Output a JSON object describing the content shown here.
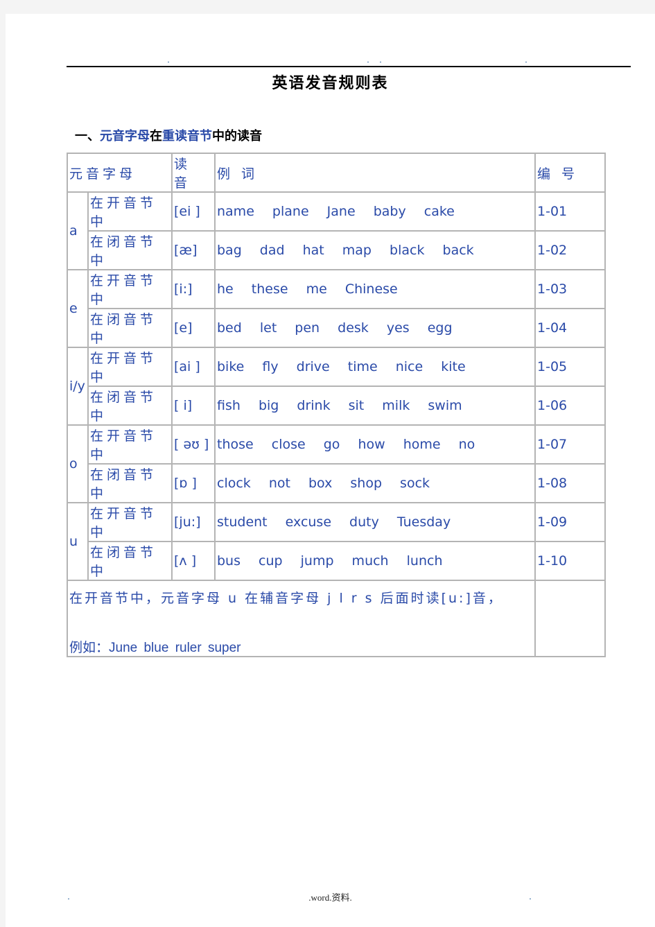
{
  "document": {
    "title": "英语发音规则表",
    "section_heading": {
      "number": "一、",
      "part1": "元音字母",
      "part2": "在",
      "part3": "重读音节",
      "part4": "中的读音"
    },
    "table": {
      "headers": {
        "vowel": "元音字母",
        "pronunciation": "读 音",
        "examples": "例 词",
        "number": "编 号"
      },
      "groups": [
        {
          "letter": "a",
          "rows": [
            {
              "syllable": "在开音节中",
              "ipa": "[ei ]",
              "words": "name plane Jane baby cake",
              "code": "1-01"
            },
            {
              "syllable": "在闭音节中",
              "ipa": "[æ]",
              "words": "bag dad hat map black back",
              "code": "1-02"
            }
          ]
        },
        {
          "letter": "e",
          "rows": [
            {
              "syllable": "在开音节中",
              "ipa": "[i:]",
              "words": "he these me Chinese",
              "code": "1-03"
            },
            {
              "syllable": "在闭音节中",
              "ipa": "[e]",
              "words": "bed let pen desk yes egg",
              "code": "1-04"
            }
          ]
        },
        {
          "letter": "i/y",
          "rows": [
            {
              "syllable": "在开音节中",
              "ipa": "[ai ]",
              "words": "bike fly drive time nice kite",
              "code": "1-05"
            },
            {
              "syllable": "在闭音节中",
              "ipa": "[ i]",
              "words": "fish big drink sit milk swim",
              "code": "1-06"
            }
          ]
        },
        {
          "letter": "o",
          "rows": [
            {
              "syllable": "在开音节中",
              "ipa": "[ əʊ ]",
              "words": "those close go how home no",
              "code": "1-07"
            },
            {
              "syllable": "在闭音节中",
              "ipa": "[ɒ ]",
              "words": "clock not box shop sock",
              "code": "1-08"
            }
          ]
        },
        {
          "letter": "u",
          "rows": [
            {
              "syllable": "在开音节中",
              "ipa": "[ju:]",
              "words": "student excuse duty Tuesday",
              "code": "1-09"
            },
            {
              "syllable": "在闭音节中",
              "ipa": "[ʌ ]",
              "words": "bus cup jump much lunch",
              "code": "1-10"
            }
          ]
        }
      ],
      "note": {
        "line1": "在开音节中，元音字母 u 在辅音字母 j l r s 后面时读[u:]音，",
        "example_label": "例如：",
        "example_words": "June blue ruler super"
      }
    },
    "footer": ".word.资料."
  }
}
